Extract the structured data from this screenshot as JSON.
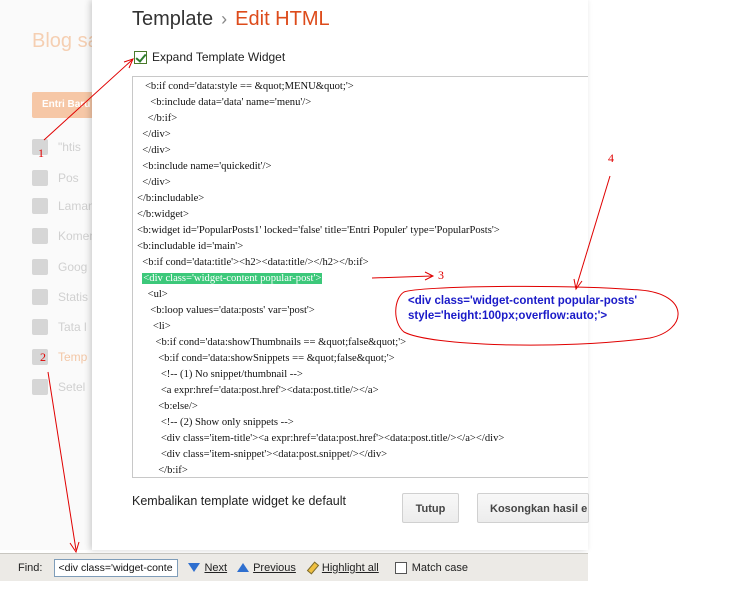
{
  "background": {
    "title": "Blog sa",
    "button_label": "Entri Baru",
    "nav": [
      {
        "label": "\"htis",
        "icon": "house-icon"
      },
      {
        "label": "Pos",
        "icon": "posts-icon"
      },
      {
        "label": "Laman",
        "icon": "pages-icon"
      },
      {
        "label": "Komen",
        "icon": "comments-icon"
      },
      {
        "label": "Goog",
        "icon": "google-plus-icon"
      },
      {
        "label": "Statis",
        "icon": "stats-icon"
      },
      {
        "label": "Tata l",
        "icon": "layout-icon"
      },
      {
        "label": "Temp",
        "icon": "template-icon"
      },
      {
        "label": "Setel",
        "icon": "settings-icon"
      }
    ]
  },
  "dialog": {
    "title": "Template",
    "separator": "›",
    "subtitle": "Edit HTML",
    "expand_label": "Expand Template Widget",
    "expand_checked": true,
    "code_lines": [
      "   <b:if cond='data:style == &quot;MENU&quot;'>",
      "     <b:include data='data' name='menu'/>",
      "    </b:if>",
      "  </div>",
      "  </div>",
      "  <b:include name='quickedit'/>",
      "  </div>",
      "</b:includable>",
      "</b:widget>",
      "<b:widget id='PopularPosts1' locked='false' title='Entri Populer' type='PopularPosts'>",
      "<b:includable id='main'>",
      "  <b:if cond='data:title'><h2><data:title/></h2></b:if>",
      "  <div class='widget-content popular-post'>",
      "    <ul>",
      "     <b:loop values='data:posts' var='post'>",
      "      <li>",
      "       <b:if cond='data:showThumbnails == &quot;false&quot;'>",
      "        <b:if cond='data:showSnippets == &quot;false&quot;'>",
      "         <!-- (1) No snippet/thumbnail -->",
      "         <a expr:href='data:post.href'><data:post.title/></a>",
      "        <b:else/>",
      "         <!-- (2) Show only snippets -->",
      "         <div class='item-title'><a expr:href='data:post.href'><data:post.title/></a></div>",
      "         <div class='item-snippet'><data:post.snippet/></div>",
      "        </b:if>"
    ],
    "reset_text": "Kembalikan template widget ke default",
    "close_button": "Tutup",
    "clear_button": "Kosongkan hasil e"
  },
  "findbar": {
    "label": "Find:",
    "value": "<div class='widget-conte",
    "next": "Next",
    "previous": "Previous",
    "highlight_all": "Highlight all",
    "match_case": "Match case",
    "match_case_checked": false
  },
  "annotations": {
    "n1": "1",
    "n2": "2",
    "n3": "3",
    "n4": "4",
    "callout": "<div class='widget-content popular-posts'\nstyle='height:100px;overflow:auto;'>",
    "color": "#e00000",
    "callout_color": "#1a1ac8"
  }
}
